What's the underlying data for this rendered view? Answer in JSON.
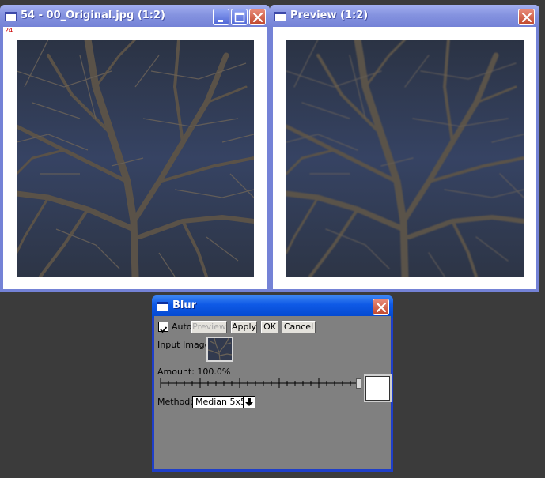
{
  "windows": {
    "original": {
      "title": "54 - 00_Original.jpg (1:2)",
      "corner_label": "24"
    },
    "preview": {
      "title": "Preview (1:2)"
    }
  },
  "blur_dialog": {
    "title": "Blur",
    "auto_checked": true,
    "auto_label": "Auto",
    "preview_button": "Preview",
    "apply_button": "Apply",
    "ok_button": "OK",
    "cancel_button": "Cancel",
    "input_image_label": "Input Image:",
    "amount_label": "Amount: 100.0%",
    "amount_value": 100.0,
    "method_label": "Method:",
    "method_value": "Median 5x5"
  },
  "icons": {
    "minimize": "minimize-icon",
    "maximize": "maximize-icon",
    "close": "close-icon",
    "check": "checkmark-icon",
    "dropdown": "dropdown-arrow-icon",
    "window": "window-icon"
  },
  "colors": {
    "inactive_titlebar": "#7482d6",
    "active_titlebar": "#0f5ae6",
    "close_button": "#c0472c",
    "desktop": "#3b3b3b",
    "dialog_body": "#808080",
    "sky": "#31394c"
  }
}
